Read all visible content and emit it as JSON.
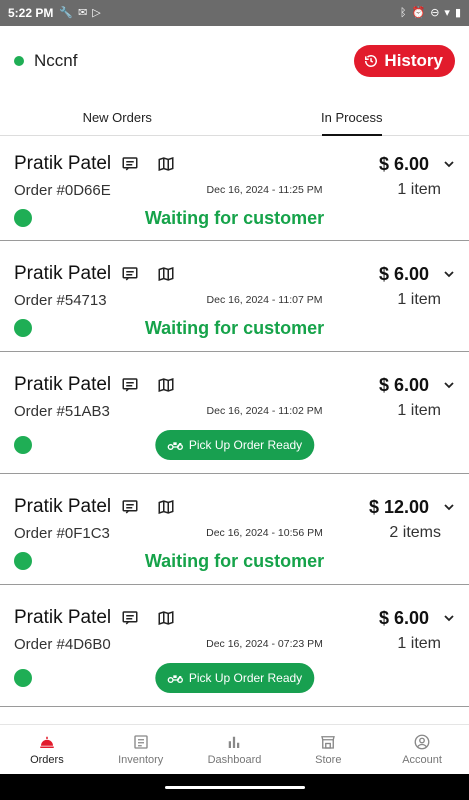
{
  "status_bar": {
    "time": "5:22 PM"
  },
  "header": {
    "store_name": "Nccnf",
    "history_label": "History"
  },
  "tabs": [
    {
      "label": "New Orders",
      "active": false
    },
    {
      "label": "In Process",
      "active": true
    }
  ],
  "orders": [
    {
      "customer": "Pratik Patel",
      "price": "$ 6.00",
      "order_no": "Order #0D66E",
      "timestamp": "Dec 16, 2024 - 11:25 PM",
      "items": "1 item",
      "status_text": "Waiting for customer",
      "action": null
    },
    {
      "customer": "Pratik Patel",
      "price": "$ 6.00",
      "order_no": "Order #54713",
      "timestamp": "Dec 16, 2024 - 11:07 PM",
      "items": "1 item",
      "status_text": "Waiting for customer",
      "action": null
    },
    {
      "customer": "Pratik Patel",
      "price": "$ 6.00",
      "order_no": "Order #51AB3",
      "timestamp": "Dec 16, 2024 - 11:02 PM",
      "items": "1 item",
      "status_text": null,
      "action": "Pick Up Order Ready"
    },
    {
      "customer": "Pratik Patel",
      "price": "$ 12.00",
      "order_no": "Order #0F1C3",
      "timestamp": "Dec 16, 2024 - 10:56 PM",
      "items": "2 items",
      "status_text": "Waiting for customer",
      "action": null
    },
    {
      "customer": "Pratik Patel",
      "price": "$ 6.00",
      "order_no": "Order #4D6B0",
      "timestamp": "Dec 16, 2024 - 07:23 PM",
      "items": "1 item",
      "status_text": null,
      "action": "Pick Up Order Ready"
    }
  ],
  "bottom_nav": [
    {
      "label": "Orders",
      "icon": "bell-icon",
      "active": true
    },
    {
      "label": "Inventory",
      "icon": "list-icon",
      "active": false
    },
    {
      "label": "Dashboard",
      "icon": "bar-chart-icon",
      "active": false
    },
    {
      "label": "Store",
      "icon": "store-icon",
      "active": false
    },
    {
      "label": "Account",
      "icon": "account-icon",
      "active": false
    }
  ],
  "colors": {
    "accent_red": "#e21b2c",
    "status_green": "#1fae55",
    "text_green": "#16a34a"
  }
}
